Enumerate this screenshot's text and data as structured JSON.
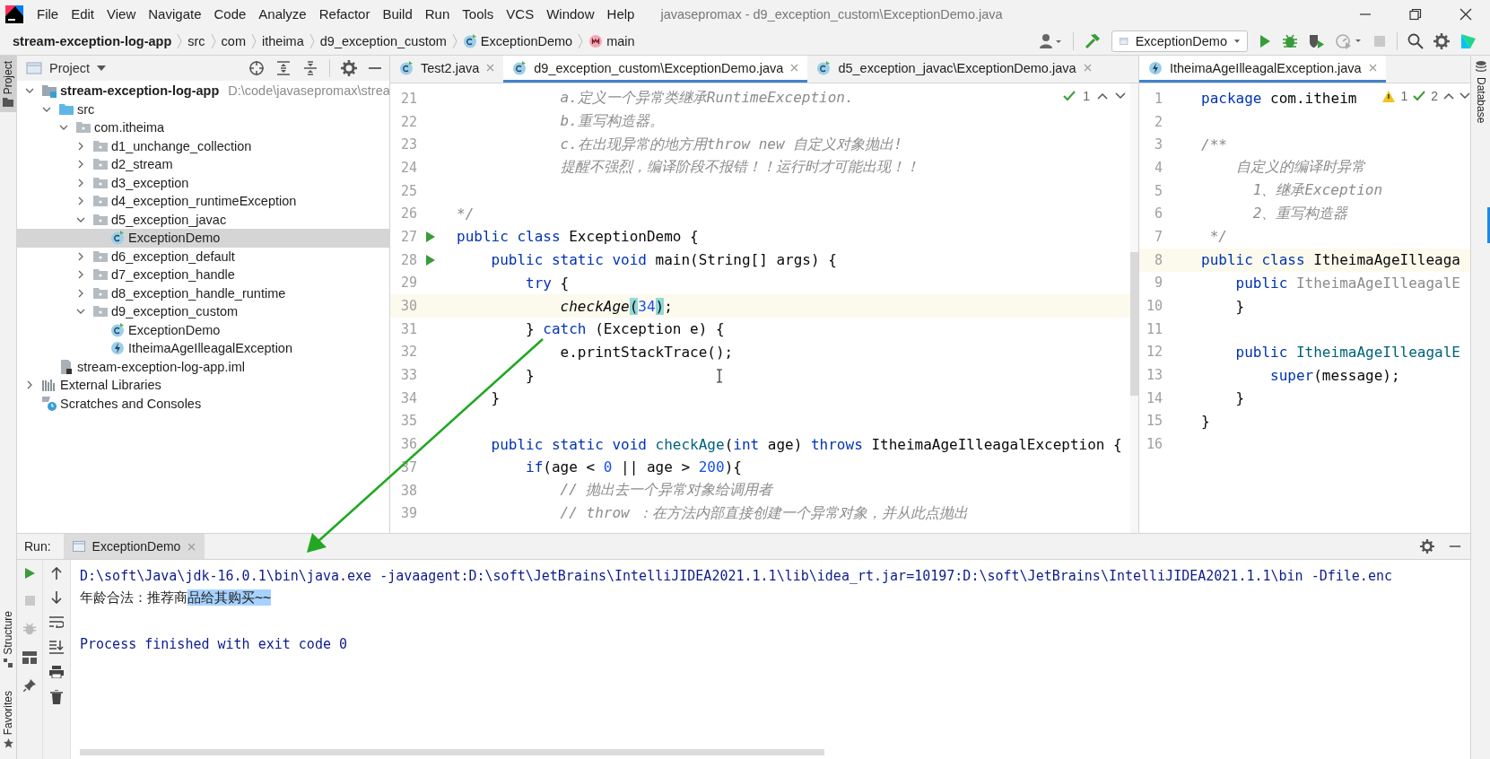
{
  "menu_bar": {
    "items": [
      "File",
      "Edit",
      "View",
      "Navigate",
      "Code",
      "Analyze",
      "Refactor",
      "Build",
      "Run",
      "Tools",
      "VCS",
      "Window",
      "Help"
    ],
    "title": "javasepromax - d9_exception_custom\\ExceptionDemo.java"
  },
  "breadcrumbs": [
    {
      "label": "stream-exception-log-app",
      "kind": "module"
    },
    {
      "label": "src",
      "kind": "dir"
    },
    {
      "label": "com",
      "kind": "dir"
    },
    {
      "label": "itheima",
      "kind": "dir"
    },
    {
      "label": "d9_exception_custom",
      "kind": "dir"
    },
    {
      "label": "ExceptionDemo",
      "kind": "class"
    },
    {
      "label": "main",
      "kind": "method"
    }
  ],
  "run_config": {
    "label": "ExceptionDemo"
  },
  "side_stripes": {
    "left_top": "Project",
    "left_bottom": [
      "Structure",
      "Favorites"
    ],
    "right": "Database"
  },
  "project_panel": {
    "title": "Project",
    "tree": [
      {
        "label": "stream-exception-log-app",
        "kind": "module",
        "path": "D:\\code\\javasepromax\\strea",
        "expanded": true,
        "selected": false,
        "children": [
          {
            "label": "src",
            "kind": "source",
            "expanded": true,
            "selected": false,
            "children": [
              {
                "label": "com.itheima",
                "kind": "package",
                "expanded": true,
                "selected": false,
                "children": [
                  {
                    "label": "d1_unchange_collection",
                    "kind": "package",
                    "expanded": false,
                    "selected": false
                  },
                  {
                    "label": "d2_stream",
                    "kind": "package",
                    "expanded": false,
                    "selected": false
                  },
                  {
                    "label": "d3_exception",
                    "kind": "package",
                    "expanded": false,
                    "selected": false
                  },
                  {
                    "label": "d4_exception_runtimeException",
                    "kind": "package",
                    "expanded": false,
                    "selected": false
                  },
                  {
                    "label": "d5_exception_javac",
                    "kind": "package",
                    "expanded": true,
                    "selected": false,
                    "children": [
                      {
                        "label": "ExceptionDemo",
                        "kind": "class",
                        "selected": true
                      }
                    ]
                  },
                  {
                    "label": "d6_exception_default",
                    "kind": "package",
                    "expanded": false,
                    "selected": false
                  },
                  {
                    "label": "d7_exception_handle",
                    "kind": "package",
                    "expanded": false,
                    "selected": false
                  },
                  {
                    "label": "d8_exception_handle_runtime",
                    "kind": "package",
                    "expanded": false,
                    "selected": false
                  },
                  {
                    "label": "d9_exception_custom",
                    "kind": "package",
                    "expanded": true,
                    "selected": false,
                    "children": [
                      {
                        "label": "ExceptionDemo",
                        "kind": "class",
                        "selected": false
                      },
                      {
                        "label": "ItheimaAgeIlleagalException",
                        "kind": "exception",
                        "selected": false
                      }
                    ]
                  }
                ]
              }
            ]
          },
          {
            "label": "stream-exception-log-app.iml",
            "kind": "iml",
            "selected": false
          }
        ]
      },
      {
        "label": "External Libraries",
        "kind": "libraries",
        "expanded": false,
        "selected": false
      },
      {
        "label": "Scratches and Consoles",
        "kind": "scratches",
        "selected": false
      }
    ]
  },
  "editor": {
    "tabs": [
      {
        "label": "Test2.java",
        "selected": false
      },
      {
        "label": "d9_exception_custom\\ExceptionDemo.java",
        "selected": true
      },
      {
        "label": "d5_exception_javac\\ExceptionDemo.java",
        "selected": false
      }
    ],
    "inspection": {
      "checks": "1"
    },
    "lines": [
      {
        "number": "21",
        "runnable": false,
        "current": false,
        "tokens": [
          {
            "text": "            a.定义一个异常类继承RuntimeException.",
            "kind": "comment"
          }
        ]
      },
      {
        "number": "22",
        "runnable": false,
        "current": false,
        "tokens": [
          {
            "text": "            b.重写构造器。",
            "kind": "comment"
          }
        ]
      },
      {
        "number": "23",
        "runnable": false,
        "current": false,
        "tokens": [
          {
            "text": "            c.在出现异常的地方用throw new 自定义对象抛出!",
            "kind": "comment"
          }
        ]
      },
      {
        "number": "24",
        "runnable": false,
        "current": false,
        "tokens": [
          {
            "text": "            提醒不强烈，编译阶段不报错！！运行时才可能出现！！",
            "kind": "comment"
          }
        ]
      },
      {
        "number": "25",
        "runnable": false,
        "current": false
      },
      {
        "number": "26",
        "runnable": false,
        "current": false,
        "tokens": [
          {
            "text": "*/",
            "kind": "comment"
          }
        ]
      },
      {
        "number": "27",
        "runnable": true,
        "current": false,
        "tokens": [
          {
            "text": "public class ",
            "kind": "kw"
          },
          {
            "text": "ExceptionDemo {",
            "kind": "plain"
          }
        ]
      },
      {
        "number": "28",
        "runnable": true,
        "current": false,
        "tokens": [
          {
            "text": "    public static void ",
            "kind": "kw"
          },
          {
            "text": "main(String[] args) {",
            "kind": "plain"
          }
        ]
      },
      {
        "number": "29",
        "runnable": false,
        "current": false,
        "tokens": [
          {
            "text": "        try",
            "kind": "kw"
          },
          {
            "text": " {",
            "kind": "plain"
          }
        ]
      },
      {
        "number": "30",
        "runnable": false,
        "current": true,
        "tokens": [
          {
            "text": "            checkAge",
            "kind": "call"
          },
          {
            "text": "(",
            "kind": "match"
          },
          {
            "text": "34",
            "kind": "num"
          },
          {
            "text": ")",
            "kind": "match"
          },
          {
            "text": ";",
            "kind": "plain"
          }
        ]
      },
      {
        "number": "31",
        "runnable": false,
        "current": false,
        "tokens": [
          {
            "text": "        } ",
            "kind": "plain"
          },
          {
            "text": "catch",
            "kind": "kw"
          },
          {
            "text": " (Exception e) {",
            "kind": "plain"
          }
        ]
      },
      {
        "number": "32",
        "runnable": false,
        "current": false,
        "tokens": [
          {
            "text": "            e.printStackTrace();",
            "kind": "plain"
          }
        ]
      },
      {
        "number": "33",
        "runnable": false,
        "current": false,
        "tokens": [
          {
            "text": "        }",
            "kind": "plain"
          }
        ]
      },
      {
        "number": "34",
        "runnable": false,
        "current": false,
        "tokens": [
          {
            "text": "    }",
            "kind": "plain"
          }
        ]
      },
      {
        "number": "35",
        "runnable": false,
        "current": false
      },
      {
        "number": "36",
        "runnable": false,
        "current": false,
        "tokens": [
          {
            "text": "    public static void ",
            "kind": "kw"
          },
          {
            "text": "checkAge",
            "kind": "decl"
          },
          {
            "text": "(",
            "kind": "plain"
          },
          {
            "text": "int",
            "kind": "kw"
          },
          {
            "text": " age) ",
            "kind": "plain"
          },
          {
            "text": "throws",
            "kind": "kw"
          },
          {
            "text": " ItheimaAgeIlleagalException {",
            "kind": "plain"
          }
        ]
      },
      {
        "number": "37",
        "runnable": false,
        "current": false,
        "tokens": [
          {
            "text": "        if",
            "kind": "kw"
          },
          {
            "text": "(age < ",
            "kind": "plain"
          },
          {
            "text": "0",
            "kind": "num"
          },
          {
            "text": " || age > ",
            "kind": "plain"
          },
          {
            "text": "200",
            "kind": "num"
          },
          {
            "text": "){",
            "kind": "plain"
          }
        ]
      },
      {
        "number": "38",
        "runnable": false,
        "current": false,
        "tokens": [
          {
            "text": "            // 抛出去一个异常对象给调用者",
            "kind": "comment"
          }
        ]
      },
      {
        "number": "39",
        "runnable": false,
        "current": false,
        "tokens": [
          {
            "text": "            // throw ：在方法内部直接创建一个异常对象，并从此点抛出",
            "kind": "comment"
          }
        ]
      }
    ]
  },
  "side_editor": {
    "tabs": [
      {
        "label": "ItheimaAgeIlleagalException.java",
        "selected": true
      }
    ],
    "inspection": {
      "warnings": "1",
      "checks": "2"
    },
    "lines": [
      {
        "number": "1",
        "current": false,
        "tokens": [
          {
            "text": "package",
            "kind": "kw"
          },
          {
            "text": " com.itheim",
            "kind": "plain"
          }
        ]
      },
      {
        "number": "2",
        "current": false
      },
      {
        "number": "3",
        "current": false,
        "tokens": [
          {
            "text": "/**",
            "kind": "comment"
          }
        ]
      },
      {
        "number": "4",
        "current": false,
        "tokens": [
          {
            "text": "    自定义的编译时异常",
            "kind": "comment"
          }
        ]
      },
      {
        "number": "5",
        "current": false,
        "tokens": [
          {
            "text": "      1、继承Exception",
            "kind": "comment"
          }
        ]
      },
      {
        "number": "6",
        "current": false,
        "tokens": [
          {
            "text": "      2、重写构造器",
            "kind": "comment"
          }
        ]
      },
      {
        "number": "7",
        "current": false,
        "tokens": [
          {
            "text": " */",
            "kind": "comment"
          }
        ]
      },
      {
        "number": "8",
        "current": true,
        "tokens": [
          {
            "text": "public class ",
            "kind": "kw"
          },
          {
            "text": "ItheimaAgeIlleaga",
            "kind": "plain"
          }
        ]
      },
      {
        "number": "9",
        "current": false,
        "tokens": [
          {
            "text": "    public ",
            "kind": "kw"
          },
          {
            "text": "ItheimaAgeIlleagalE",
            "kind": "unused"
          }
        ]
      },
      {
        "number": "10",
        "current": false,
        "tokens": [
          {
            "text": "    }",
            "kind": "plain"
          }
        ]
      },
      {
        "number": "11",
        "current": false
      },
      {
        "number": "12",
        "current": false,
        "tokens": [
          {
            "text": "    public ",
            "kind": "kw"
          },
          {
            "text": "ItheimaAgeIlleagalE",
            "kind": "decl"
          }
        ]
      },
      {
        "number": "13",
        "current": false,
        "tokens": [
          {
            "text": "        super",
            "kind": "kw"
          },
          {
            "text": "(message);",
            "kind": "plain"
          }
        ]
      },
      {
        "number": "14",
        "current": false,
        "tokens": [
          {
            "text": "    }",
            "kind": "plain"
          }
        ]
      },
      {
        "number": "15",
        "current": false,
        "tokens": [
          {
            "text": "}",
            "kind": "plain"
          }
        ]
      },
      {
        "number": "16",
        "current": false
      }
    ]
  },
  "run_panel": {
    "label": "Run:",
    "tabs": [
      {
        "label": "ExceptionDemo",
        "selected": true
      }
    ],
    "console": [
      {
        "kind": "command",
        "segments": [
          {
            "text": "D:\\soft\\Java\\jdk-16.0.1\\bin\\java.exe -javaagent:D:\\soft\\JetBrains\\IntelliJIDEA2021.1.1\\lib\\idea_rt.jar=10197:D:\\soft\\JetBrains\\IntelliJIDEA2021.1.1\\bin -Dfile.enc",
            "selected": false
          }
        ]
      },
      {
        "kind": "output",
        "segments": [
          {
            "text": "年龄合法：推荐商",
            "selected": false
          },
          {
            "text": "品给其购买~~",
            "selected": true
          }
        ]
      },
      {
        "kind": "status",
        "segments": [
          {
            "text": "Process finished with exit code 0",
            "selected": false
          }
        ]
      }
    ]
  }
}
